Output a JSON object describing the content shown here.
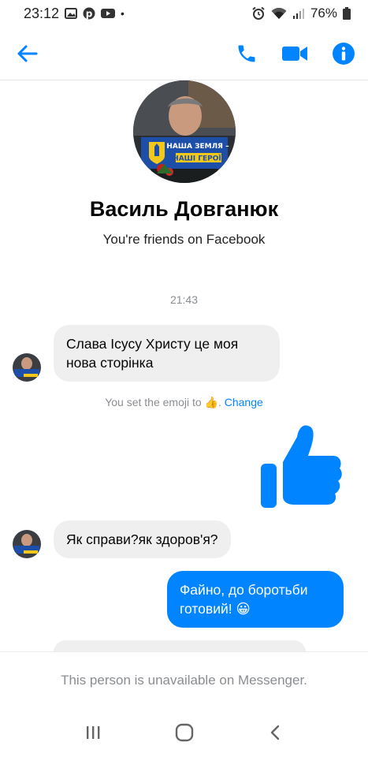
{
  "status_bar": {
    "time": "23:12",
    "dot": "•",
    "battery_percent": "76%",
    "left_icons": [
      "image-icon",
      "pinterest-icon",
      "youtube-icon"
    ],
    "right_icons": [
      "alarm-icon",
      "wifi-icon",
      "signal-icon",
      "battery-icon"
    ]
  },
  "header": {
    "icons": [
      "back-arrow-icon",
      "phone-icon",
      "video-icon",
      "info-icon"
    ],
    "accent_color": "#0084ff"
  },
  "profile": {
    "name": "Василь Довганюк",
    "subtitle": "You're friends on Facebook",
    "avatar_banner_line1": "НАША ЗЕМЛЯ –",
    "avatar_banner_line2": "НАШІ ГЕРОЇ!"
  },
  "conversation": {
    "timestamp": "21:43",
    "messages": [
      {
        "sender": "contact",
        "text": "Слава Ісусу Христу це моя нова сторінка"
      },
      {
        "sender": "me",
        "type": "emoji",
        "emoji": "thumbs-up-icon"
      },
      {
        "sender": "contact",
        "text": "Як справи?як здоров'я?"
      },
      {
        "sender": "me",
        "text": "Файно, до боротьби готовий!",
        "emoji": "😀"
      }
    ],
    "system_message": {
      "text": "You set the emoji to",
      "emoji": "👍",
      "period": ".",
      "link": "Change"
    }
  },
  "footer": {
    "notice": "This person is unavailable on Messenger."
  },
  "nav_bar": {
    "icons": [
      "recent-apps-icon",
      "home-icon",
      "back-icon"
    ]
  },
  "colors": {
    "messenger_blue": "#0084ff",
    "incoming_bubble": "#efefef",
    "secondary_text": "#8a8d91"
  }
}
